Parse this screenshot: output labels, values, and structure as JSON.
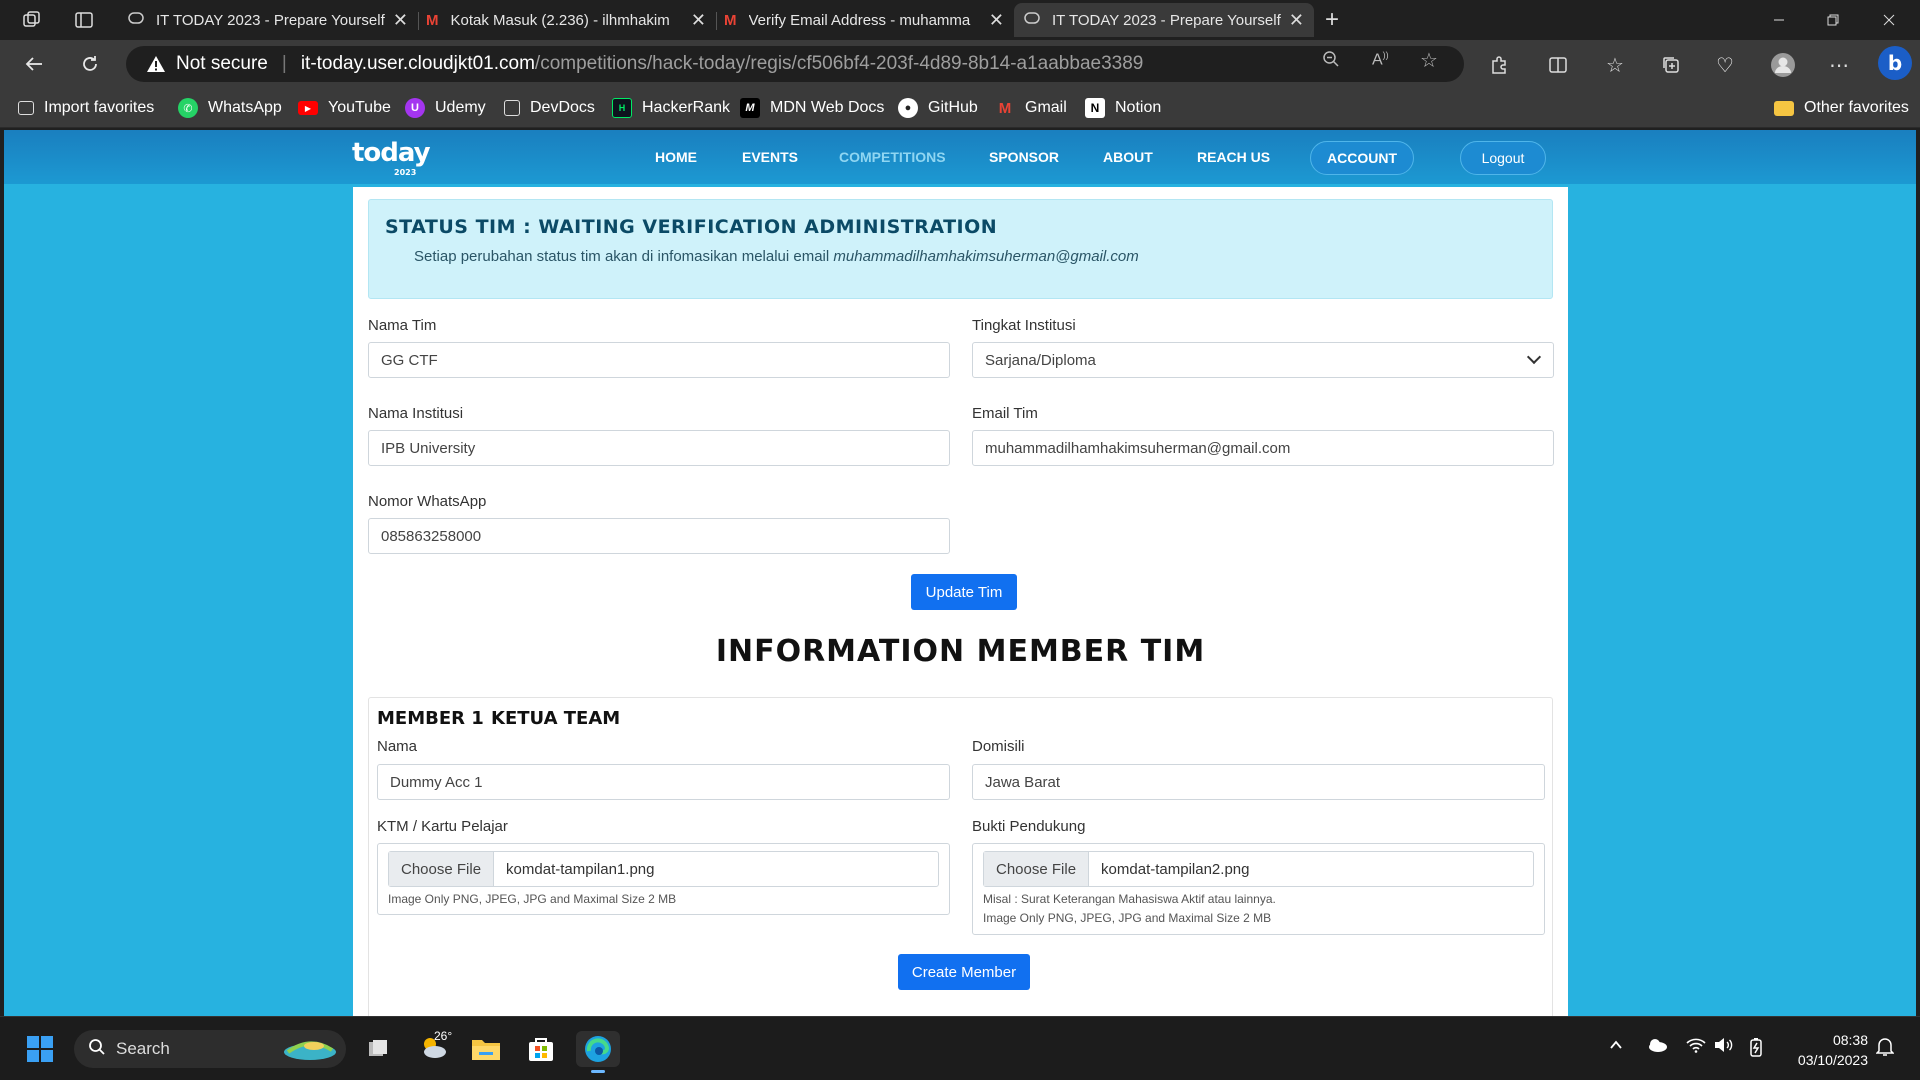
{
  "browser": {
    "tabs": [
      {
        "title": "IT TODAY 2023 - Prepare Yourself",
        "icon": "site-icon",
        "active": false
      },
      {
        "title": "Kotak Masuk (2.236) - ilhmhakim",
        "icon": "gmail-icon",
        "active": false
      },
      {
        "title": "Verify Email Address - muhamma",
        "icon": "gmail-icon",
        "active": false
      },
      {
        "title": "IT TODAY 2023 - Prepare Yourself",
        "icon": "site-icon",
        "active": true
      }
    ],
    "security_label": "Not secure",
    "url_host": "it-today.user.cloudjkt01.com",
    "url_path": "/competitions/hack-today/regis/cf506bf4-203f-4d89-8b14-a1aabbae3389",
    "bookmarks": [
      {
        "label": "Import favorites",
        "icon": "import-icon",
        "color": "#ffffff"
      },
      {
        "label": "WhatsApp",
        "icon": "whatsapp-icon",
        "color": "#25d366"
      },
      {
        "label": "YouTube",
        "icon": "youtube-icon",
        "color": "#ff0000"
      },
      {
        "label": "Udemy",
        "icon": "udemy-icon",
        "color": "#a435f0"
      },
      {
        "label": "DevDocs",
        "icon": "devdocs-icon",
        "color": "#ffffff"
      },
      {
        "label": "HackerRank",
        "icon": "hackerrank-icon",
        "color": "#00ea64"
      },
      {
        "label": "MDN Web Docs",
        "icon": "mdn-icon",
        "color": "#ffffff"
      },
      {
        "label": "GitHub",
        "icon": "github-icon",
        "color": "#ffffff"
      },
      {
        "label": "Gmail",
        "icon": "gmail-icon",
        "color": "#ea4335"
      },
      {
        "label": "Notion",
        "icon": "notion-icon",
        "color": "#ffffff"
      }
    ],
    "other_favorites": "Other favorites"
  },
  "site": {
    "logo_text": "today",
    "logo_year": "2023",
    "nav": [
      {
        "label": "HOME",
        "current": false
      },
      {
        "label": "EVENTS",
        "current": false
      },
      {
        "label": "COMPETITIONS",
        "current": true
      },
      {
        "label": "SPONSOR",
        "current": false
      },
      {
        "label": "ABOUT",
        "current": false
      },
      {
        "label": "REACH US",
        "current": false
      }
    ],
    "account_label": "ACCOUNT",
    "logout_label": "Logout",
    "colors": {
      "page_bg": "#27b2e0",
      "primary_button": "#1170f0",
      "alert_bg": "#cff2fa"
    }
  },
  "status": {
    "heading": "STATUS TIM : WAITING VERIFICATION ADMINISTRATION",
    "message": "Setiap perubahan status tim akan di infomasikan melalui email",
    "email": "muhammadilhamhakimsuherman@gmail.com"
  },
  "team_form": {
    "nama_tim_label": "Nama Tim",
    "nama_tim_value": "GG CTF",
    "tingkat_label": "Tingkat Institusi",
    "tingkat_value": "Sarjana/Diploma",
    "institusi_label": "Nama Institusi",
    "institusi_value": "IPB University",
    "email_label": "Email Tim",
    "email_value": "muhammadilhamhakimsuherman@gmail.com",
    "wa_label": "Nomor WhatsApp",
    "wa_value": "085863258000",
    "update_button": "Update Tim"
  },
  "members": {
    "heading": "INFORMATION MEMBER TIM",
    "member_title": "MEMBER 1",
    "member_role": "KETUA TEAM",
    "nama_label": "Nama",
    "nama_value": "Dummy Acc 1",
    "domisili_label": "Domisili",
    "domisili_value": "Jawa Barat",
    "ktm_label": "KTM / Kartu Pelajar",
    "ktm_choose": "Choose File",
    "ktm_file": "komdat-tampilan1.png",
    "ktm_hint": "Image Only PNG, JPEG, JPG and Maximal Size 2 MB",
    "bukti_label": "Bukti Pendukung",
    "bukti_choose": "Choose File",
    "bukti_file": "komdat-tampilan2.png",
    "bukti_hint1": "Misal : Surat Keterangan Mahasiswa Aktif atau lainnya.",
    "bukti_hint2": "Image Only PNG, JPEG, JPG and Maximal Size 2 MB",
    "create_button": "Create Member"
  },
  "taskbar": {
    "search_label": "Search",
    "weather_temp": "26°",
    "time": "08:38",
    "date": "03/10/2023"
  }
}
